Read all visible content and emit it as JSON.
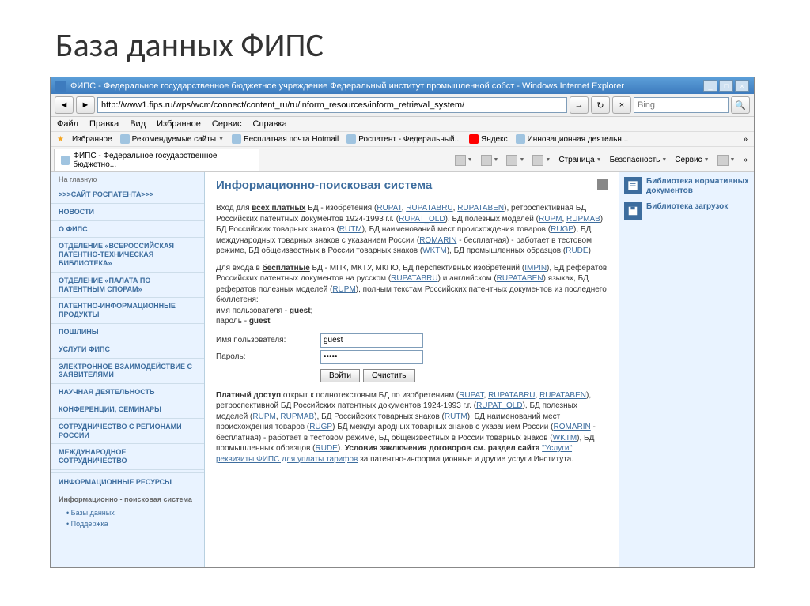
{
  "slide": {
    "title": "База данных ФИПС"
  },
  "window": {
    "title": "ФИПС - Федеральное государственное бюджетное учреждение Федеральный институт промышленной собст - Windows Internet Explorer",
    "url": "http://www1.fips.ru/wps/wcm/connect/content_ru/ru/inform_resources/inform_retrieval_system/",
    "search_placeholder": "Bing"
  },
  "menu": [
    "Файл",
    "Правка",
    "Вид",
    "Избранное",
    "Сервис",
    "Справка"
  ],
  "favbar": {
    "label": "Избранное",
    "items": [
      "Рекомендуемые сайты",
      "Бесплатная почта Hotmail",
      "Роспатент - Федеральный...",
      "Яндекс",
      "Инновационная деятельн..."
    ]
  },
  "tab": {
    "label": "ФИПС - Федеральное государственное бюджетно..."
  },
  "tabtools": [
    "Страница",
    "Безопасность",
    "Сервис"
  ],
  "sidebar": {
    "top": "На главную",
    "items": [
      ">>>САЙТ РОСПАТЕНТА>>>",
      "НОВОСТИ",
      "О ФИПС",
      "ОТДЕЛЕНИЕ «ВСЕРОССИЙСКАЯ ПАТЕНТНО-ТЕХНИЧЕСКАЯ БИБЛИОТЕКА»",
      "ОТДЕЛЕНИЕ «ПАЛАТА ПО ПАТЕНТНЫМ СПОРАМ»",
      "ПАТЕНТНО-ИНФОРМАЦИОННЫЕ ПРОДУКТЫ",
      "ПОШЛИНЫ",
      "УСЛУГИ ФИПС",
      "ЭЛЕКТРОННОЕ ВЗАИМОДЕЙСТВИЕ С ЗАЯВИТЕЛЯМИ",
      "НАУЧНАЯ ДЕЯТЕЛЬНОСТЬ",
      "КОНФЕРЕНЦИИ, СЕМИНАРЫ",
      "СОТРУДНИЧЕСТВО С РЕГИОНАМИ РОССИИ",
      "МЕЖДУНАРОДНОЕ СОТРУДНИЧЕСТВО"
    ],
    "section": "ИНФОРМАЦИОННЫЕ РЕСУРСЫ",
    "active": "Информационно - поисковая система",
    "subs": [
      "Базы данных",
      "Поддержка"
    ]
  },
  "main": {
    "heading": "Информационно-поисковая система",
    "p1_pre": "Вход для ",
    "p1_bold1": "всех платных",
    "p1_t1": " БД - изобретения (",
    "links1": [
      "RUPAT",
      "RUPATABRU",
      "RUPATABEN"
    ],
    "p1_t2": "), ретроспективная БД Российских патентных документов 1924-1993 г.г. (",
    "link_old": "RUPAT_OLD",
    "p1_t3": "), БД полезных моделей (",
    "links2": [
      "RUPM",
      "RUPMAB"
    ],
    "p1_t4": "), БД Российских товарных знаков (",
    "link_rutm": "RUTM",
    "p1_t5": "), БД наименований мест происхождения товаров (",
    "link_rugp": "RUGP",
    "p1_t6": "), БД международных товарных знаков с указанием России (",
    "link_romarin": "ROMARIN",
    "p1_t7": " - бесплатная) - работает в тестовом режиме, БД общеизвестных в России товарных знаков (",
    "link_wktm": "WKTM",
    "p1_t8": "), БД промышленных образцов (",
    "link_rude": "RUDE",
    "p1_t9": ")",
    "p2_pre": "Для входа в ",
    "p2_bold": "бесплатные",
    "p2_t1": " БД - МПК, МКТУ, МКПО, БД перспективных изобретений (",
    "link_impin": "IMPIN",
    "p2_t2": "), БД рефератов Российских патентных документов на русском (",
    "link_r1": "RUPATABRU",
    "p2_t3": ") и английском (",
    "link_r2": "RUPATABEN",
    "p2_t4": ") языках, БД рефератов полезных моделей (",
    "link_r3": "RUPM",
    "p2_t5": "), полным текстам Российских патентных документов из последнего бюллетеня:",
    "p2_user": "имя пользователя - ",
    "p2_userv": "guest",
    "p2_pass": "пароль  - ",
    "p2_passv": "guest",
    "form": {
      "user_label": "Имя пользователя:",
      "user_value": "guest",
      "pass_label": "Пароль:",
      "pass_value": "•••••",
      "login": "Войти",
      "clear": "Очистить"
    },
    "p3_bold": "Платный доступ",
    "p3_t1": " открыт к полнотекстовым БД по изобретениям (",
    "links3": [
      "RUPAT",
      "RUPATABRU",
      "RUPATABEN"
    ],
    "p3_t2": "), ретроспективной БД Российских патентных документов 1924-1993 г.г. (",
    "p3_t3": "), БД полезных моделей (",
    "p3_t4": "), БД Российских товарных знаков (",
    "p3_t5": "), БД наименований мест происхождения товаров (",
    "p3_t6": ") БД международных товарных знаков с указанием России (",
    "p3_t7": " - бесплатная) - работает в тестовом режиме, БД общеизвестных в России товарных знаков (",
    "p3_t8": "), БД промышленных образцов (",
    "p3_t9": "). ",
    "p3_bold2": "Условия заключения договоров см. раздел сайта ",
    "link_uslugi": "\"Услуги\"",
    "p3_semi": "; ",
    "link_rekv": "реквизиты ФИПС для уплаты тарифов",
    "p3_end": " за патентно-информационные и другие услуги Института."
  },
  "rightcol": {
    "items": [
      {
        "icon": "book",
        "text": "Библиотека нормативных документов"
      },
      {
        "icon": "disk",
        "text": "Библиотека загрузок"
      }
    ]
  }
}
